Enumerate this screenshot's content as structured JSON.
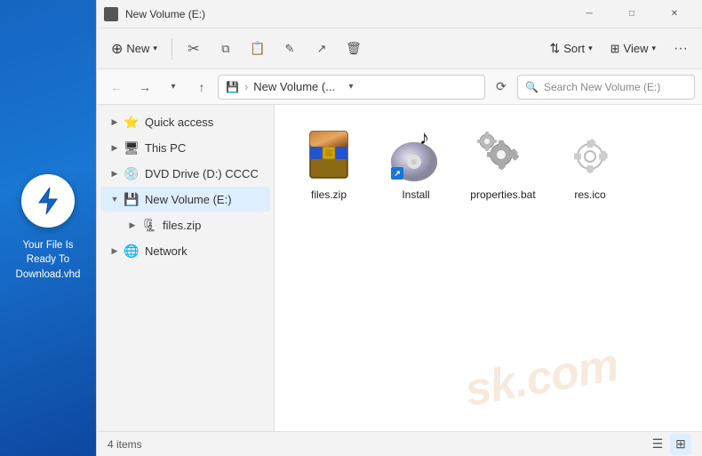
{
  "leftPanel": {
    "text": "Your File Is Ready To Download.vhd"
  },
  "titleBar": {
    "title": "New Volume (E:)",
    "minimize": "─",
    "maximize": "□",
    "close": "✕"
  },
  "toolbar": {
    "new_label": "New",
    "sort_label": "Sort",
    "view_label": "View",
    "more_label": "···"
  },
  "addressBar": {
    "path_text": "New Volume (...",
    "search_placeholder": "Search New Volume (E:)"
  },
  "sidebar": {
    "items": [
      {
        "label": "Quick access",
        "icon": "⭐",
        "type": "top",
        "chevron": "▶"
      },
      {
        "label": "This PC",
        "icon": "🖥",
        "type": "top",
        "chevron": "▶"
      },
      {
        "label": "DVD Drive (D:) CCCC",
        "icon": "💿",
        "type": "top",
        "chevron": "▶"
      },
      {
        "label": "New Volume (E:)",
        "icon": "💾",
        "type": "active",
        "chevron": "▼"
      },
      {
        "label": "files.zip",
        "icon": "🗜",
        "type": "sub",
        "chevron": "▶"
      },
      {
        "label": "Network",
        "icon": "🌐",
        "type": "top",
        "chevron": "▶"
      }
    ]
  },
  "files": [
    {
      "name": "files.zip",
      "type": "zip"
    },
    {
      "name": "Install",
      "type": "cd"
    },
    {
      "name": "properties.bat",
      "type": "bat"
    },
    {
      "name": "res.ico",
      "type": "ico"
    }
  ],
  "statusBar": {
    "count": "4 items"
  }
}
